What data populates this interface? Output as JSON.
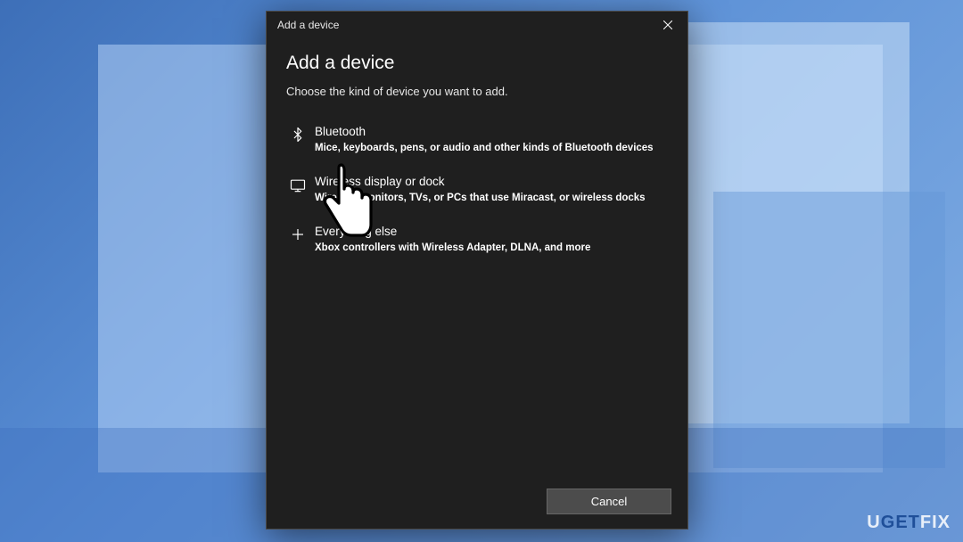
{
  "window": {
    "titlebar": "Add a device",
    "heading": "Add a device",
    "subheading": "Choose the kind of device you want to add."
  },
  "options": [
    {
      "title": "Bluetooth",
      "desc": "Mice, keyboards, pens, or audio and other kinds of Bluetooth devices"
    },
    {
      "title": "Wireless display or dock",
      "desc": "Wireless monitors, TVs, or PCs that use Miracast, or wireless docks"
    },
    {
      "title": "Everything else",
      "desc": "Xbox controllers with Wireless Adapter, DLNA, and more"
    }
  ],
  "buttons": {
    "cancel": "Cancel"
  },
  "watermark": {
    "pre": "U",
    "mid": "G",
    "mid2": "T",
    "post": "FIX"
  }
}
